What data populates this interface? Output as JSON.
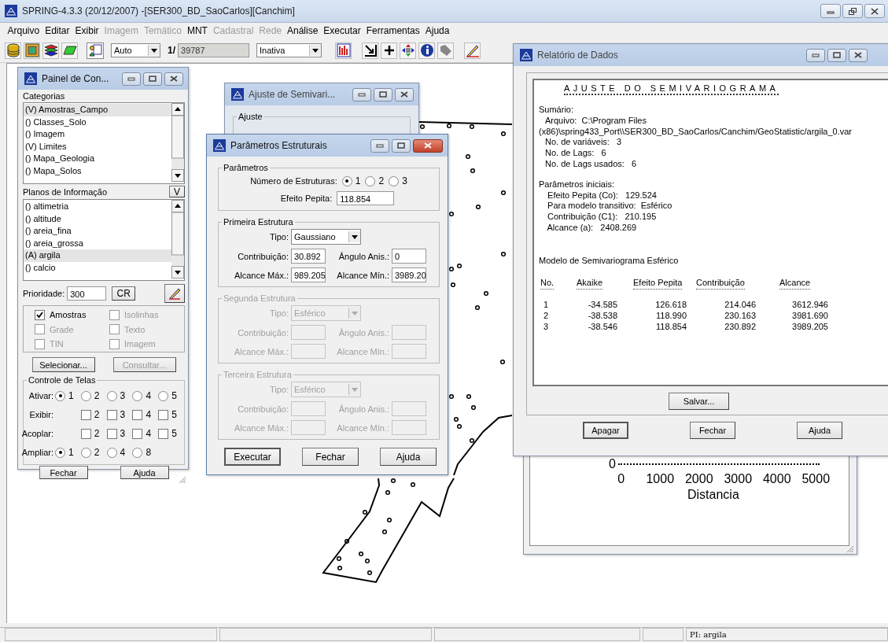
{
  "window": {
    "title": "SPRING-4.3.3 (20/12/2007) -[SER300_BD_SaoCarlos][Canchim]"
  },
  "menu": [
    {
      "label": "Arquivo",
      "disabled": false
    },
    {
      "label": "Editar",
      "disabled": false
    },
    {
      "label": "Exibir",
      "disabled": false
    },
    {
      "label": "Imagem",
      "disabled": true
    },
    {
      "label": "Temático",
      "disabled": true
    },
    {
      "label": "MNT",
      "disabled": false
    },
    {
      "label": "Cadastral",
      "disabled": true
    },
    {
      "label": "Rede",
      "disabled": true
    },
    {
      "label": "Análise",
      "disabled": false
    },
    {
      "label": "Executar",
      "disabled": false
    },
    {
      "label": "Ferramentas",
      "disabled": false
    },
    {
      "label": "Ajuda",
      "disabled": false
    }
  ],
  "toolbar": {
    "scale_mode": "Auto",
    "scale_prefix": "1/",
    "scale": "39787",
    "scale_disabled": true,
    "view_mode": "Inativa"
  },
  "control_panel": {
    "title": "Painel de Con...",
    "categories_label": "Categorias",
    "categories": [
      {
        "label": "(V) Amostras_Campo",
        "selected": true
      },
      {
        "label": "() Classes_Solo",
        "selected": false
      },
      {
        "label": "() Imagem",
        "selected": false
      },
      {
        "label": "(V) Limites",
        "selected": false
      },
      {
        "label": "() Mapa_Geologia",
        "selected": false
      },
      {
        "label": "() Mapa_Solos",
        "selected": false
      }
    ],
    "planes_label": "Planos de Informação",
    "planes_button": "V",
    "planes": [
      {
        "label": "() altimetria",
        "selected": false
      },
      {
        "label": "() altitude",
        "selected": false
      },
      {
        "label": "() areia_fina",
        "selected": false
      },
      {
        "label": "() areia_grossa",
        "selected": false
      },
      {
        "label": "(A) argila",
        "selected": true
      },
      {
        "label": "() calcio",
        "selected": false
      }
    ],
    "priority_label": "Prioridade:",
    "priority": "300",
    "cr_button": "CR",
    "options": [
      {
        "label": "Amostras",
        "checked": true,
        "disabled": false
      },
      {
        "label": "Isolinhas",
        "checked": false,
        "disabled": true
      },
      {
        "label": "Grade",
        "checked": false,
        "disabled": true
      },
      {
        "label": "Texto",
        "checked": false,
        "disabled": true
      },
      {
        "label": "TIN",
        "checked": false,
        "disabled": true
      },
      {
        "label": "Imagem",
        "checked": false,
        "disabled": true
      }
    ],
    "select_button": {
      "label": "Selecionar...",
      "disabled": false
    },
    "consult_button": {
      "label": "Consultar...",
      "disabled": true
    },
    "screens": {
      "title": "Controle de Telas",
      "rows": [
        {
          "kind": "radio",
          "label": "Ativar:",
          "options": [
            {
              "label": "1",
              "selected": true
            },
            {
              "label": "2",
              "selected": false
            },
            {
              "label": "3",
              "selected": false
            },
            {
              "label": "4",
              "selected": false
            },
            {
              "label": "5",
              "selected": false
            }
          ]
        },
        {
          "kind": "check",
          "label": "Exibir:",
          "options": [
            {
              "label": "2",
              "checked": false
            },
            {
              "label": "3",
              "checked": false
            },
            {
              "label": "4",
              "checked": false
            },
            {
              "label": "5",
              "checked": false
            }
          ]
        },
        {
          "kind": "check",
          "label": "Acoplar:",
          "options": [
            {
              "label": "2",
              "checked": false
            },
            {
              "label": "3",
              "checked": false
            },
            {
              "label": "4",
              "checked": false
            },
            {
              "label": "5",
              "checked": false
            }
          ]
        },
        {
          "kind": "radio",
          "label": "Ampliar:",
          "options": [
            {
              "label": "1",
              "selected": true
            },
            {
              "label": "2",
              "selected": false
            },
            {
              "label": "4",
              "selected": false
            },
            {
              "label": "8",
              "selected": false
            }
          ]
        }
      ]
    },
    "buttons": [
      "Fechar",
      "Ajuda"
    ]
  },
  "fit_dialog": {
    "title": "Ajuste de Semivari...",
    "group": "Ajuste"
  },
  "structures_dialog": {
    "title": "Parâmetros Estruturais",
    "params_group": "Parâmetros",
    "count_label": "Número de Estruturas:",
    "counts": [
      {
        "label": "1",
        "selected": true
      },
      {
        "label": "2",
        "selected": false
      },
      {
        "label": "3",
        "selected": false
      }
    ],
    "nugget_label": "Efeito Pepita:",
    "nugget": "118.854",
    "structures": [
      {
        "title": "Primeira Estrutura",
        "disabled": false,
        "type_label": "Tipo:",
        "type": "Gaussiano",
        "contribution_label": "Contribuição:",
        "contribution": "30.892",
        "angle_label": "Ângulo Anis.:",
        "angle": "0",
        "range_max_label": "Alcance Máx.:",
        "range_max": "989.205",
        "range_min_label": "Alcance Mín.:",
        "range_min": "3989.20"
      },
      {
        "title": "Segunda Estrutura",
        "disabled": true,
        "type_label": "Tipo:",
        "type": "Esférico",
        "contribution_label": "Contribuição:",
        "angle_label": "Ângulo Anis.:",
        "range_max_label": "Alcance Máx.:",
        "range_min_label": "Alcance Mín.:"
      },
      {
        "title": "Terceira Estrutura",
        "disabled": true,
        "type_label": "Tipo:",
        "type": "Esférico",
        "contribution_label": "Contribuição:",
        "angle_label": "Ângulo Anis.:",
        "range_max_label": "Alcance Máx.:",
        "range_min_label": "Alcance Mín.:"
      }
    ],
    "buttons": [
      "Executar",
      "Fechar",
      "Ajuda"
    ]
  },
  "variogram_window": {
    "y_tick": "0",
    "x_ticks": [
      "0",
      "1000",
      "2000",
      "3000",
      "4000",
      "5000"
    ],
    "x_label": "Distancia"
  },
  "report": {
    "title": "Relatório de Dados",
    "heading": "AJUSTE DO SEMIVARIOGRAMA",
    "sections": [
      {
        "label": "Sumário:",
        "lines": [
          {
            "kind": "item",
            "text": "Arquivo:  C:\\Program Files"
          },
          {
            "kind": "wrap",
            "text": "(x86)\\spring433_Port\\\\SER300_BD_SaoCarlos/Canchim/GeoStatistic/argila_0.var"
          },
          {
            "kind": "item",
            "text": "No. de variáveis:   3"
          },
          {
            "kind": "item",
            "text": "No. de Lags:   6"
          },
          {
            "kind": "item",
            "text": "No. de Lags usados:   6"
          }
        ]
      },
      {
        "label": "Parâmetros iniciais:",
        "lines": [
          {
            "kind": "item",
            "text": " Efeito Pepita (Co):   129.524"
          },
          {
            "kind": "item",
            "text": " Para modelo transitivo:  Esférico"
          },
          {
            "kind": "item",
            "text": " Contribuição (C1):   210.195"
          },
          {
            "kind": "item",
            "text": " Alcance (a):   2408.269"
          }
        ]
      }
    ],
    "model_title": "Modelo de Semivariograma Esférico",
    "columns": [
      "No.",
      "Akaike",
      "Efeito Pepita",
      "Contribuição",
      "Alcance"
    ],
    "rows": [
      {
        "cells": [
          "1",
          "-34.585",
          "126.618",
          "214.046",
          "3612.946"
        ]
      },
      {
        "cells": [
          "2",
          "-38.538",
          "118.990",
          "230.163",
          "3981.690"
        ]
      },
      {
        "cells": [
          "3",
          "-38.546",
          "118.854",
          "230.892",
          "3989.205"
        ]
      }
    ],
    "save_button": "Salvar...",
    "buttons": [
      "Apagar",
      "Fechar",
      "Ajuda"
    ]
  },
  "status_bar": {
    "text": "PI: argila"
  }
}
